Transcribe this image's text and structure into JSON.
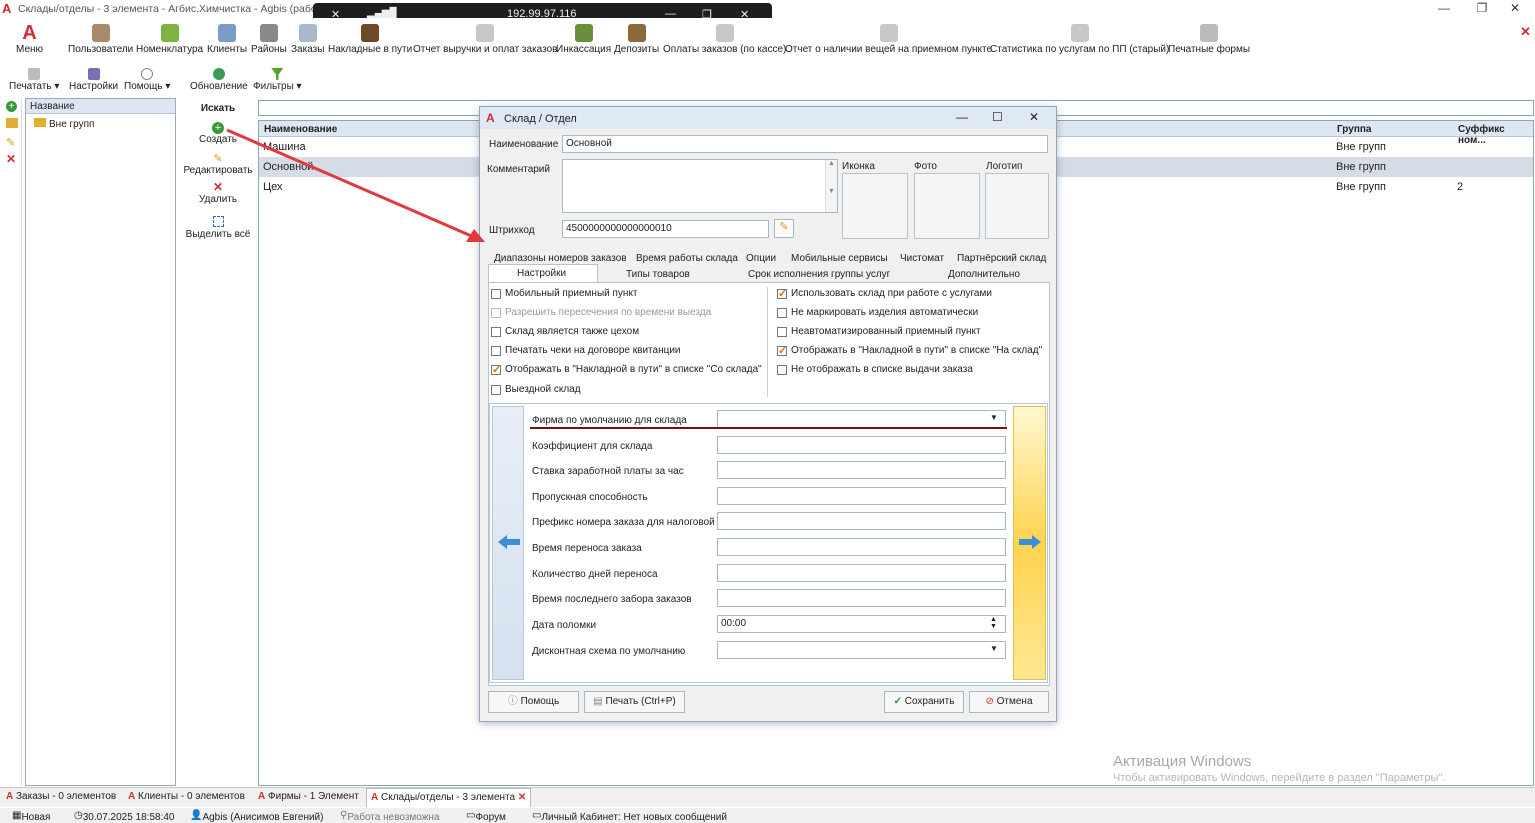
{
  "window": {
    "title": "Склады/отделы - 3 элемента - Агбис.Химчистка - Agbis (рабо",
    "remote_ip": "192.99.97.116"
  },
  "ribbon": {
    "menu": "Меню",
    "items": [
      "Пользователи",
      "Номенклатура",
      "Клиенты",
      "Районы",
      "Заказы",
      "Накладные в пути",
      "Отчет выручки и оплат заказов",
      "Инкассация",
      "Депозиты",
      "Оплаты заказов (по кассе)",
      "Отчет о наличии вещей на приемном пункте",
      "Статистика по услугам по ПП (старый)",
      "Печатные формы"
    ]
  },
  "toolbar": {
    "print": "Печатать",
    "settings": "Настройки",
    "help": "Помощь",
    "refresh": "Обновление",
    "filters": "Фильтры"
  },
  "tree": {
    "header": "Название",
    "node": "Вне групп"
  },
  "actions": {
    "search": "Искать",
    "create": "Создать",
    "edit": "Редактировать",
    "delete": "Удалить",
    "select_all": "Выделить всё"
  },
  "grid": {
    "headers": [
      "Наименование",
      "Группа",
      "Суффикс ном..."
    ],
    "rows": [
      {
        "name": "Машина",
        "group": "Вне групп",
        "suffix": ""
      },
      {
        "name": "Основной",
        "group": "Вне групп",
        "suffix": ""
      },
      {
        "name": "Цех",
        "group": "Вне групп",
        "suffix": "2"
      }
    ]
  },
  "dialog": {
    "title": "Склад / Отдел",
    "name_label": "Наименование",
    "name_value": "Основной",
    "comment_label": "Комментарий",
    "barcode_label": "Штрихкод",
    "barcode_value": "4500000000000000010",
    "image_labels": [
      "Иконка",
      "Фото",
      "Логотип"
    ],
    "tabs_row1": [
      "Диапазоны номеров заказов",
      "Время работы склада",
      "Опции",
      "Мобильные сервисы",
      "Чистомат",
      "Партнёрский склад"
    ],
    "tabs_row2": [
      "Настройки",
      "Типы товаров",
      "Срок исполнения группы услуг",
      "Дополнительно"
    ],
    "checks_left": [
      {
        "label": "Мобильный приемный пункт",
        "checked": false,
        "disabled": false
      },
      {
        "label": "Разрешить пересечения по времени выезда",
        "checked": false,
        "disabled": true
      },
      {
        "label": "Склад является также цехом",
        "checked": false,
        "disabled": false
      },
      {
        "label": "Печатать чеки на договоре квитанции",
        "checked": false,
        "disabled": false
      },
      {
        "label": "Отображать в \"Накладной в пути\" в списке \"Со склада\"",
        "checked": true,
        "disabled": false
      },
      {
        "label": "Выездной склад",
        "checked": false,
        "disabled": false
      }
    ],
    "checks_right": [
      {
        "label": "Использовать склад при работе с услугами",
        "checked": true
      },
      {
        "label": "Не маркировать изделия автоматически",
        "checked": false
      },
      {
        "label": "Неавтоматизированный приемный пункт",
        "checked": false
      },
      {
        "label": "Отображать в \"Накладной в пути\" в списке \"На склад\"",
        "checked": true
      },
      {
        "label": "Не отображать в списке выдачи заказа",
        "checked": false
      }
    ],
    "fields": [
      {
        "label": "Фирма по умолчанию для склада",
        "value": "",
        "type": "select"
      },
      {
        "label": "Коэффициент для склада",
        "value": "",
        "type": "text"
      },
      {
        "label": "Ставка заработной платы за час",
        "value": "",
        "type": "text"
      },
      {
        "label": "Пропускная способность",
        "value": "",
        "type": "text"
      },
      {
        "label": "Префикс номера заказа для налоговой",
        "value": "",
        "type": "text"
      },
      {
        "label": "Время переноса заказа",
        "value": "",
        "type": "text"
      },
      {
        "label": "Количество дней переноса",
        "value": "",
        "type": "text"
      },
      {
        "label": "Время последнего забора заказов",
        "value": "",
        "type": "text"
      },
      {
        "label": "Дата поломки",
        "value": "00:00",
        "type": "spin"
      },
      {
        "label": "Дисконтная схема по умолчанию",
        "value": "",
        "type": "select"
      }
    ],
    "buttons": {
      "help": "Помощь",
      "print": "Печать (Ctrl+P)",
      "save": "Сохранить",
      "cancel": "Отмена"
    }
  },
  "bottom_tabs": [
    "Заказы - 0 элементов",
    "Клиенты - 0 элементов",
    "Фирмы - 1 Элемент",
    "Склады/отделы - 3 элемента"
  ],
  "statusbar": {
    "mode": "Новая",
    "datetime": "30.07.2025 18:58:40",
    "user": "Agbis (Анисимов Евгений)",
    "work": "Работа невозможна",
    "forum": "Форум",
    "cabinet": "Личный Кабинет: Нет новых сообщений"
  },
  "watermark": {
    "line1": "Активация Windows",
    "line2": "Чтобы активировать Windows, перейдите в раздел \"Параметры\"."
  },
  "colors": {
    "accent": "#d32f2f",
    "arrow": "#e0393e",
    "underline": "#7a0f1a",
    "nav_blue": "#3a8fd6",
    "check": "#e07000"
  }
}
